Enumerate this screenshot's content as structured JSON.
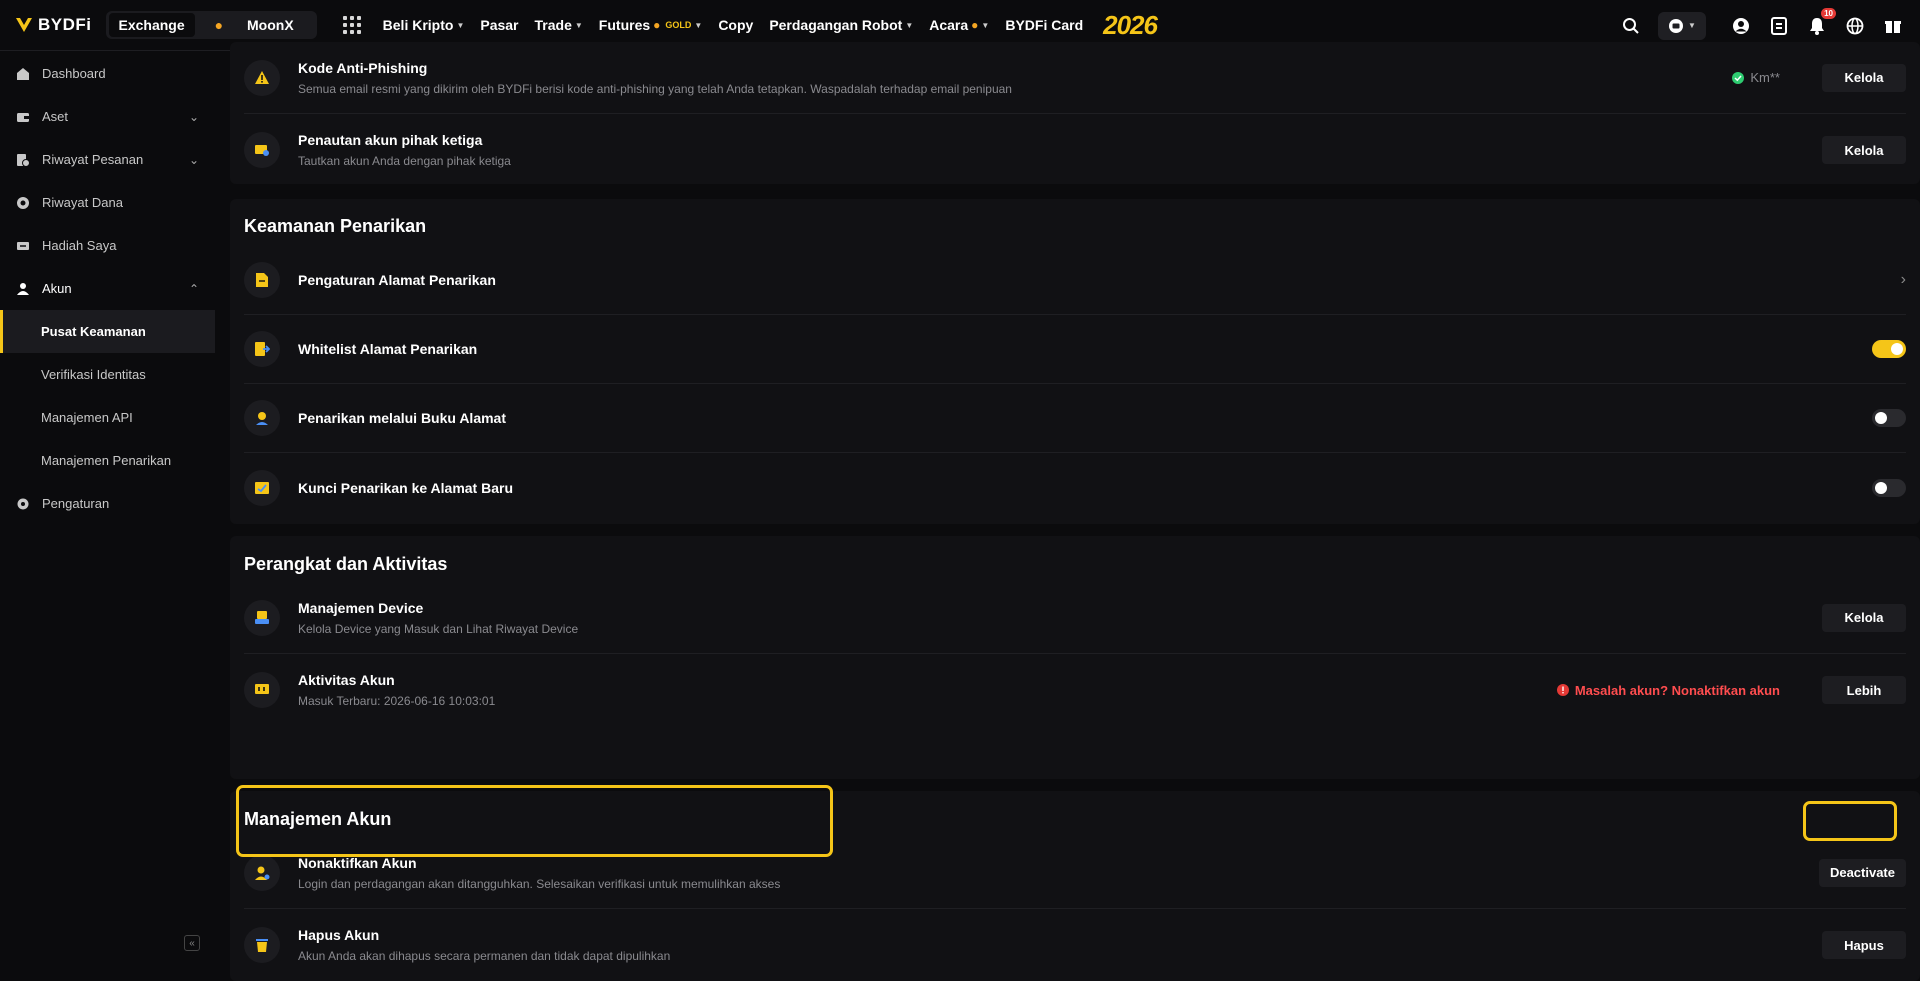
{
  "topbar": {
    "brand": "BYDFi",
    "segments": [
      "Exchange",
      "MoonX"
    ],
    "nav": [
      "Beli Kripto",
      "Pasar",
      "Trade",
      "Futures",
      "Copy",
      "Perdagangan Robot",
      "Acara",
      "BYDFi Card"
    ],
    "gold_tag": "GOLD",
    "year_badge": "2026",
    "notif_count": "10"
  },
  "sidebar": {
    "items": [
      "Dashboard",
      "Aset",
      "Riwayat Pesanan",
      "Riwayat Dana",
      "Hadiah Saya",
      "Akun",
      "Pusat Keamanan",
      "Verifikasi Identitas",
      "Manajemen API",
      "Manajemen Penarikan",
      "Pengaturan"
    ]
  },
  "security": {
    "anti_phishing": {
      "title": "Kode Anti-Phishing",
      "desc": "Semua email resmi yang dikirim oleh BYDFi berisi kode anti-phishing yang telah Anda tetapkan. Waspadalah terhadap email penipuan",
      "status": "Km**",
      "button": "Kelola"
    },
    "third_party": {
      "title": "Penautan akun pihak ketiga",
      "desc": "Tautkan akun Anda dengan pihak ketiga",
      "button": "Kelola"
    }
  },
  "withdrawal": {
    "title": "Keamanan Penarikan",
    "items": [
      {
        "title": "Pengaturan Alamat Penarikan"
      },
      {
        "title": "Whitelist Alamat Penarikan",
        "toggle": true
      },
      {
        "title": "Penarikan melalui Buku Alamat",
        "toggle": false
      },
      {
        "title": "Kunci Penarikan ke Alamat Baru",
        "toggle": false
      }
    ]
  },
  "devices": {
    "title": "Perangkat dan Aktivitas",
    "device": {
      "title": "Manajemen Device",
      "desc": "Kelola Device yang Masuk dan Lihat Riwayat Device",
      "button": "Kelola"
    },
    "activity": {
      "title": "Aktivitas Akun",
      "desc": "Masuk Terbaru: 2026-06-16 10:03:01",
      "warning": "Masalah akun? Nonaktifkan akun",
      "button": "Lebih"
    }
  },
  "account": {
    "title": "Manajemen Akun",
    "deactivate": {
      "title": "Nonaktifkan Akun",
      "desc": "Login dan perdagangan akan ditangguhkan. Selesaikan verifikasi untuk memulihkan akses",
      "button": "Deactivate"
    },
    "delete": {
      "title": "Hapus Akun",
      "desc": "Akun Anda akan dihapus secara permanen dan tidak dapat dipulihkan",
      "button": "Hapus"
    }
  },
  "colors": {
    "accent": "#f5c518",
    "warning": "#e53935",
    "success": "#2ecc71"
  }
}
